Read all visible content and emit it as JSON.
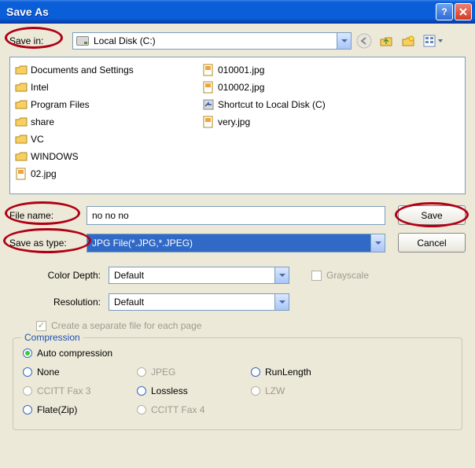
{
  "title": "Save As",
  "save_in_label": "Save in:",
  "location": "Local Disk (C:)",
  "files_col1": [
    {
      "name": "Documents and Settings",
      "type": "folder"
    },
    {
      "name": "Intel",
      "type": "folder"
    },
    {
      "name": "Program Files",
      "type": "folder"
    },
    {
      "name": "share",
      "type": "folder"
    },
    {
      "name": "VC",
      "type": "folder"
    },
    {
      "name": "WINDOWS",
      "type": "folder"
    }
  ],
  "files_col2": [
    {
      "name": "02.jpg",
      "type": "file"
    },
    {
      "name": "010001.jpg",
      "type": "file"
    },
    {
      "name": "010002.jpg",
      "type": "file"
    },
    {
      "name": "Shortcut to Local Disk (C)",
      "type": "shortcut"
    },
    {
      "name": "very.jpg",
      "type": "file"
    }
  ],
  "filename_label": "File name:",
  "filename_value": "no no no",
  "savetype_label": "Save as type:",
  "savetype_value": "JPG File(*.JPG,*.JPEG)",
  "save_button": "Save",
  "cancel_button": "Cancel",
  "colordepth_label": "Color Depth:",
  "colordepth_value": "Default",
  "grayscale_label": "Grayscale",
  "resolution_label": "Resolution:",
  "resolution_value": "Default",
  "separate_page_label": "Create a separate file for each page",
  "compression_label": "Compression",
  "compression_options": [
    {
      "label": "Auto compression",
      "checked": true,
      "enabled": true
    },
    {
      "label": "None",
      "checked": false,
      "enabled": true
    },
    {
      "label": "JPEG",
      "checked": false,
      "enabled": false
    },
    {
      "label": "RunLength",
      "checked": false,
      "enabled": true
    },
    {
      "label": "CCITT Fax 3",
      "checked": false,
      "enabled": false
    },
    {
      "label": "Lossless",
      "checked": false,
      "enabled": true
    },
    {
      "label": "LZW",
      "checked": false,
      "enabled": false
    },
    {
      "label": "Flate(Zip)",
      "checked": false,
      "enabled": true
    },
    {
      "label": "CCITT Fax 4",
      "checked": false,
      "enabled": false
    }
  ]
}
